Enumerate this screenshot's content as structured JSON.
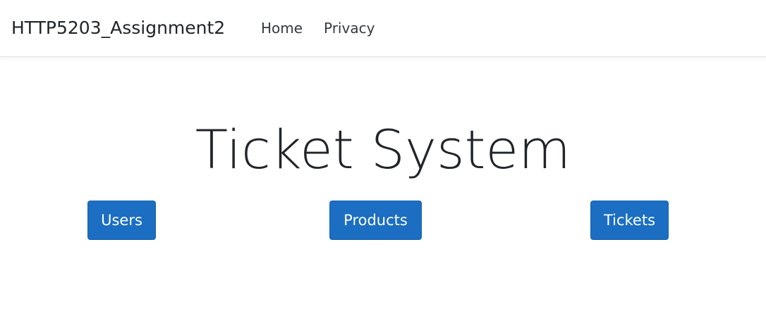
{
  "navbar": {
    "brand": "HTTP5203_Assignment2",
    "links": [
      "Home",
      "Privacy"
    ]
  },
  "main": {
    "title": "Ticket System",
    "buttons": [
      "Users",
      "Products",
      "Tickets"
    ]
  },
  "colors": {
    "button_bg": "#1b6ec2",
    "button_text": "#ffffff",
    "text": "#212529"
  }
}
